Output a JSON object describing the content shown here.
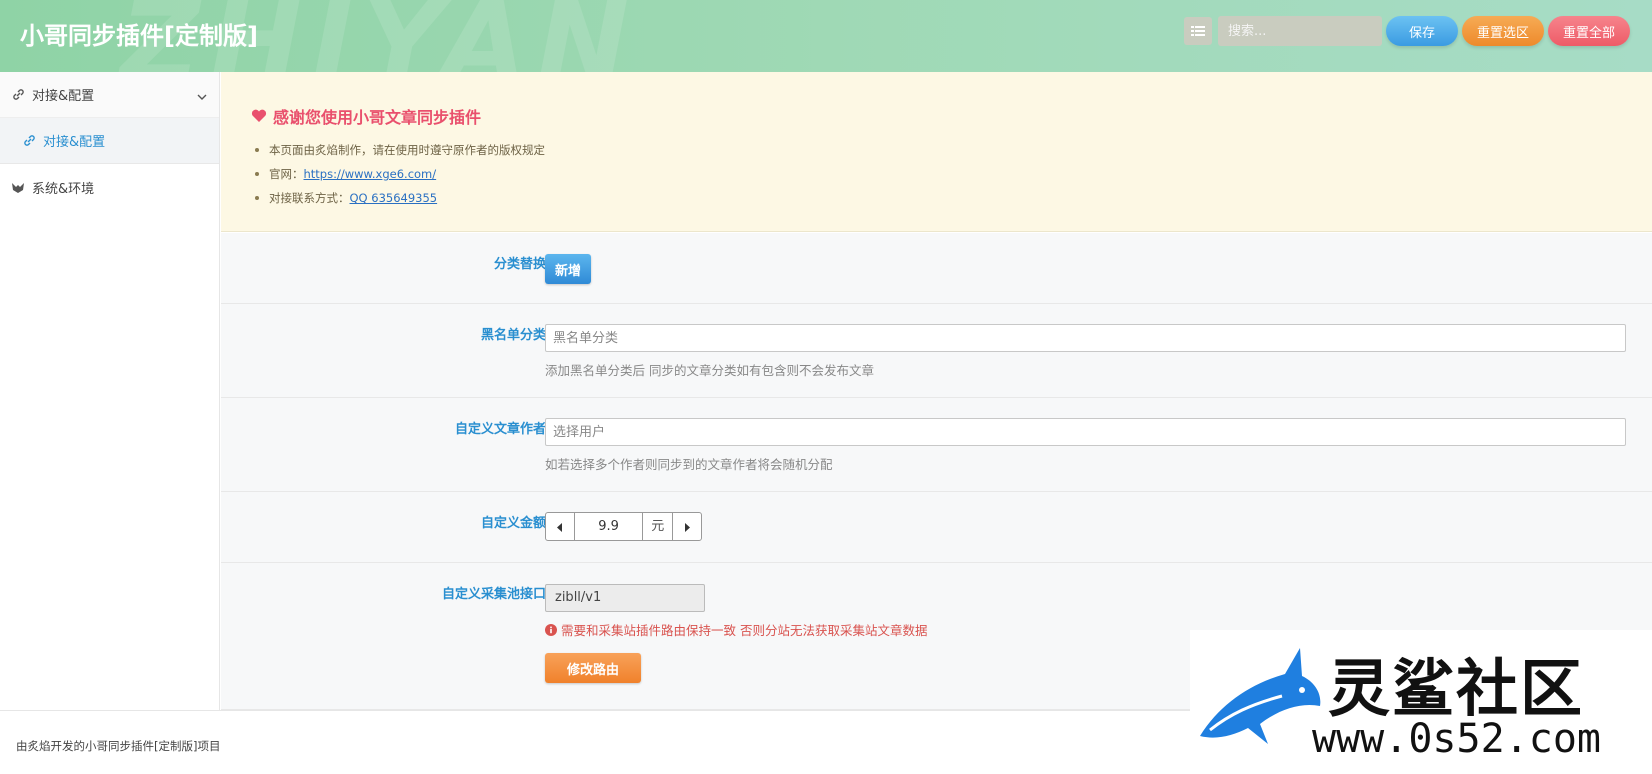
{
  "header": {
    "title": "小哥同步插件[定制版]",
    "search_placeholder": "搜索...",
    "save_label": "保存",
    "reset_selection_label": "重置选区",
    "reset_all_label": "重置全部"
  },
  "sidebar": {
    "items": [
      {
        "label": "对接&配置",
        "icon": "link-icon",
        "expanded": true
      },
      {
        "label": "对接&配置",
        "icon": "link-icon",
        "active": true
      },
      {
        "label": "系统&环境",
        "icon": "logo-icon"
      }
    ]
  },
  "notice": {
    "title": "感谢您使用小哥文章同步插件",
    "line1": "本页面由炙焰制作，请在使用时遵守原作者的版权规定",
    "line2_prefix": "官网：",
    "line2_link": "https://www.xge6.com/",
    "line3_prefix": "对接联系方式：",
    "line3_link": "QQ 635649355"
  },
  "form": {
    "category_replace": {
      "label": "分类替换",
      "button": "新增"
    },
    "blacklist": {
      "label": "黑名单分类",
      "placeholder": "黑名单分类",
      "hint": "添加黑名单分类后 同步的文章分类如有包含则不会发布文章"
    },
    "author": {
      "label": "自定义文章作者",
      "placeholder": "选择用户",
      "hint": "如若选择多个作者则同步到的文章作者将会随机分配"
    },
    "amount": {
      "label": "自定义金额",
      "value": "9.9",
      "unit": "元"
    },
    "route": {
      "label": "自定义采集池接口",
      "value": "zibll/v1",
      "warning": "需要和采集站插件路由保持一致 否则分站无法获取采集站文章数据",
      "button": "修改路由"
    }
  },
  "footer": {
    "text": "由炙焰开发的小哥同步插件[定制版]项目"
  },
  "watermark": {
    "brand": "灵鲨社区",
    "url": "www.0s52.com"
  },
  "colors": {
    "accent": "#2a8fd0",
    "save": "#3a9be2",
    "reset_selection": "#ee8a2b",
    "reset_all": "#ee5b67",
    "warning": "#d9534f",
    "notice_title": "#e9506d"
  }
}
